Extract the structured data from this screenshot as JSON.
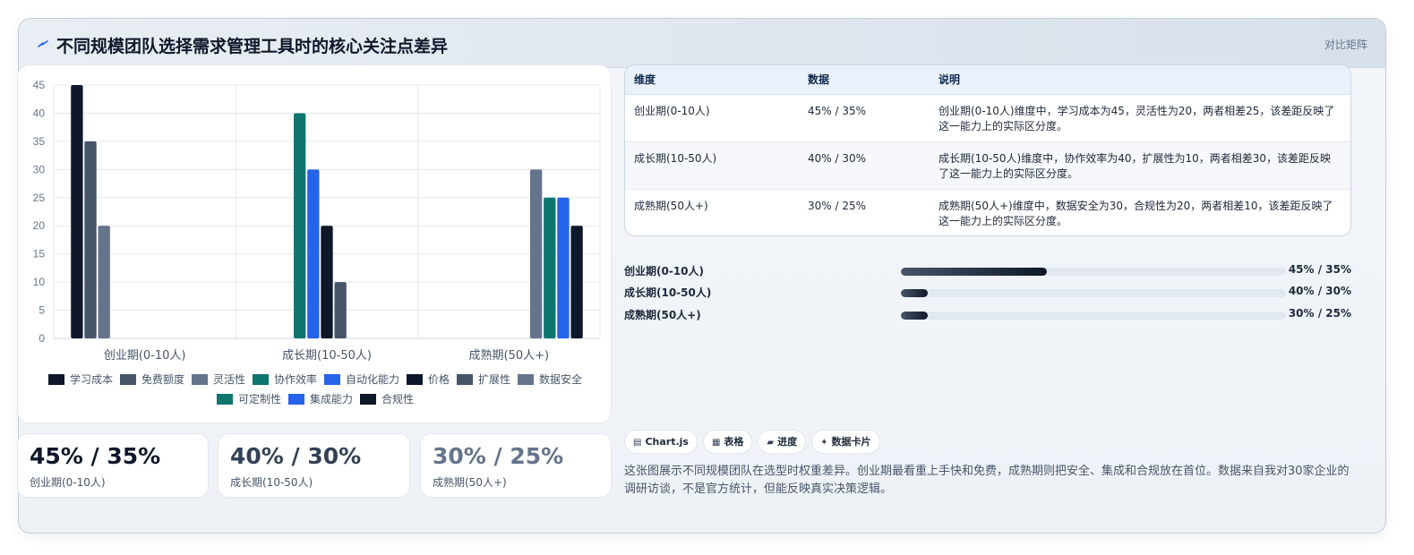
{
  "header": {
    "title": "不同规模团队选择需求管理工具时的核心关注点差异",
    "tag": "对比矩阵"
  },
  "chart_data": {
    "type": "bar",
    "categories": [
      "创业期(0-10人)",
      "成长期(10-50人)",
      "成熟期(50人+)"
    ],
    "ylim": [
      0,
      45
    ],
    "yticks": [
      0,
      5,
      10,
      15,
      20,
      25,
      30,
      35,
      40,
      45
    ],
    "grid": true,
    "legend_position": "bottom",
    "series": [
      {
        "name": "学习成本",
        "color": "#0f172a",
        "values": [
          45,
          null,
          null
        ]
      },
      {
        "name": "免费额度",
        "color": "#475569",
        "values": [
          35,
          null,
          null
        ]
      },
      {
        "name": "灵活性",
        "color": "#64748b",
        "values": [
          20,
          null,
          null
        ]
      },
      {
        "name": "协作效率",
        "color": "#0f766e",
        "values": [
          null,
          40,
          null
        ]
      },
      {
        "name": "自动化能力",
        "color": "#2563eb",
        "values": [
          null,
          30,
          null
        ]
      },
      {
        "name": "价格",
        "color": "#0f172a",
        "values": [
          null,
          20,
          null
        ]
      },
      {
        "name": "扩展性",
        "color": "#475569",
        "values": [
          null,
          10,
          null
        ]
      },
      {
        "name": "数据安全",
        "color": "#64748b",
        "values": [
          null,
          null,
          30
        ]
      },
      {
        "name": "可定制性",
        "color": "#0f766e",
        "values": [
          null,
          null,
          25
        ]
      },
      {
        "name": "集成能力",
        "color": "#2563eb",
        "values": [
          null,
          null,
          25
        ]
      },
      {
        "name": "合规性",
        "color": "#0f172a",
        "values": [
          null,
          null,
          20
        ]
      }
    ]
  },
  "stats": [
    {
      "value": "45% / 35%",
      "label": "创业期(0-10人)",
      "color": "#0f172a"
    },
    {
      "value": "40% / 30%",
      "label": "成长期(10-50人)",
      "color": "#334155"
    },
    {
      "value": "30% / 25%",
      "label": "成熟期(50人+)",
      "color": "#64748b"
    }
  ],
  "table": {
    "headers": [
      "维度",
      "数据",
      "说明"
    ],
    "rows": [
      {
        "dim": "创业期(0-10人)",
        "data": "45% / 35%",
        "note": "创业期(0-10人)维度中，学习成本为45，灵活性为20，两者相差25，该差距反映了这一能力上的实际区分度。"
      },
      {
        "dim": "成长期(10-50人)",
        "data": "40% / 30%",
        "note": "成长期(10-50人)维度中，协作效率为40，扩展性为10，两者相差30，该差距反映了这一能力上的实际区分度。"
      },
      {
        "dim": "成熟期(50人+)",
        "data": "30% / 25%",
        "note": "成熟期(50人+)维度中，数据安全为30，合规性为20，两者相差10，该差距反映了这一能力上的实际区分度。"
      }
    ]
  },
  "progress": [
    {
      "label": "创业期(0-10人)",
      "value": "45% / 35%",
      "fill_pct": 38
    },
    {
      "label": "成长期(10-50人)",
      "value": "40% / 30%",
      "fill_pct": 7
    },
    {
      "label": "成熟期(50人+)",
      "value": "30% / 25%",
      "fill_pct": 7
    }
  ],
  "chips": [
    {
      "icon": "chart-icon",
      "glyph": "▤",
      "label": "Chart.js"
    },
    {
      "icon": "table-icon",
      "glyph": "▦",
      "label": "表格"
    },
    {
      "icon": "progress-icon",
      "glyph": "▰",
      "label": "进度"
    },
    {
      "icon": "sparkle-icon",
      "glyph": "✦",
      "label": "数据卡片"
    }
  ],
  "description": "这张图展示不同规模团队在选型时权重差异。创业期最看重上手快和免费，成熟期则把安全、集成和合规放在首位。数据来自我对30家企业的调研访谈，不是官方统计，但能反映真实决策逻辑。"
}
